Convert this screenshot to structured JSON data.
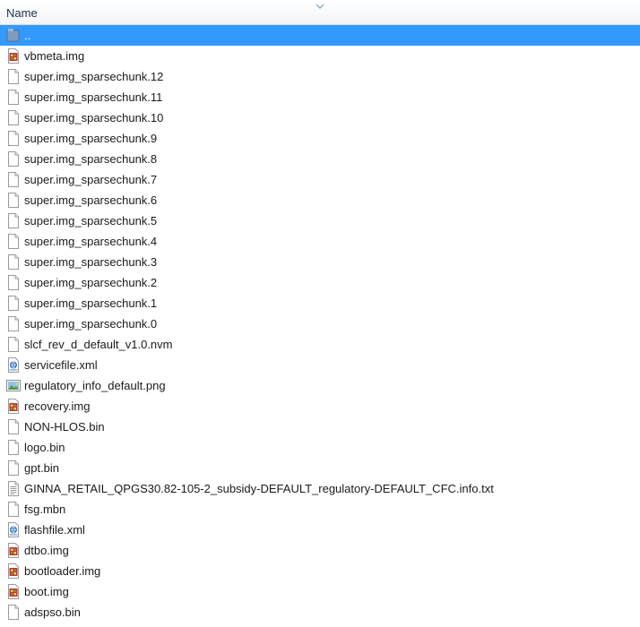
{
  "header": {
    "name_label": "Name"
  },
  "files": [
    {
      "name": "..",
      "icon": "folder-up-icon",
      "selected": true
    },
    {
      "name": "vbmeta.img",
      "icon": "disk-image-icon"
    },
    {
      "name": "super.img_sparsechunk.12",
      "icon": "file-icon"
    },
    {
      "name": "super.img_sparsechunk.11",
      "icon": "file-icon"
    },
    {
      "name": "super.img_sparsechunk.10",
      "icon": "file-icon"
    },
    {
      "name": "super.img_sparsechunk.9",
      "icon": "file-icon"
    },
    {
      "name": "super.img_sparsechunk.8",
      "icon": "file-icon"
    },
    {
      "name": "super.img_sparsechunk.7",
      "icon": "file-icon"
    },
    {
      "name": "super.img_sparsechunk.6",
      "icon": "file-icon"
    },
    {
      "name": "super.img_sparsechunk.5",
      "icon": "file-icon"
    },
    {
      "name": "super.img_sparsechunk.4",
      "icon": "file-icon"
    },
    {
      "name": "super.img_sparsechunk.3",
      "icon": "file-icon"
    },
    {
      "name": "super.img_sparsechunk.2",
      "icon": "file-icon"
    },
    {
      "name": "super.img_sparsechunk.1",
      "icon": "file-icon"
    },
    {
      "name": "super.img_sparsechunk.0",
      "icon": "file-icon"
    },
    {
      "name": "slcf_rev_d_default_v1.0.nvm",
      "icon": "file-icon"
    },
    {
      "name": "servicefile.xml",
      "icon": "xml-file-icon"
    },
    {
      "name": "regulatory_info_default.png",
      "icon": "image-file-icon"
    },
    {
      "name": "recovery.img",
      "icon": "disk-image-icon"
    },
    {
      "name": "NON-HLOS.bin",
      "icon": "file-icon"
    },
    {
      "name": "logo.bin",
      "icon": "file-icon"
    },
    {
      "name": "gpt.bin",
      "icon": "file-icon"
    },
    {
      "name": "GINNA_RETAIL_QPGS30.82-105-2_subsidy-DEFAULT_regulatory-DEFAULT_CFC.info.txt",
      "icon": "text-file-icon"
    },
    {
      "name": "fsg.mbn",
      "icon": "file-icon"
    },
    {
      "name": "flashfile.xml",
      "icon": "xml-file-icon"
    },
    {
      "name": "dtbo.img",
      "icon": "disk-image-icon"
    },
    {
      "name": "bootloader.img",
      "icon": "disk-image-icon"
    },
    {
      "name": "boot.img",
      "icon": "disk-image-icon"
    },
    {
      "name": "adspso.bin",
      "icon": "file-icon"
    }
  ]
}
